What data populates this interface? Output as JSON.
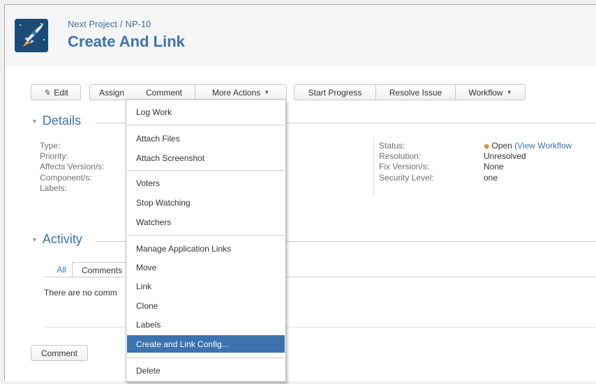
{
  "header": {
    "project": "Next Project",
    "separator": "/",
    "issue_key": "NP-10",
    "title": "Create And Link"
  },
  "toolbar": {
    "edit": "Edit",
    "assign": "Assign",
    "comment": "Comment",
    "more_actions": "More Actions",
    "start_progress": "Start Progress",
    "resolve_issue": "Resolve Issue",
    "workflow": "Workflow"
  },
  "details": {
    "heading": "Details",
    "left_labels": [
      "Type:",
      "Priority:",
      "Affects Version/s:",
      "Component/s:",
      "Labels:"
    ],
    "right": [
      {
        "label": "Status:",
        "value": "Open",
        "link": "View Workflow"
      },
      {
        "label": "Resolution:",
        "value": "Unresolved"
      },
      {
        "label": "Fix Version/s:",
        "value": "None"
      },
      {
        "label": "Security Level:",
        "value": "one"
      }
    ],
    "status_paren": "("
  },
  "activity": {
    "heading": "Activity",
    "tabs": [
      "All",
      "Comments"
    ],
    "empty_text": "There are no comm",
    "comment_button": "Comment"
  },
  "menu": {
    "groups": [
      [
        "Log Work"
      ],
      [
        "Attach Files",
        "Attach Screenshot"
      ],
      [
        "Voters",
        "Stop Watching",
        "Watchers"
      ],
      [
        "Manage Application Links",
        "Move",
        "Link",
        "Clone",
        "Labels",
        "Create and Link Config..."
      ],
      [
        "Delete"
      ]
    ],
    "highlighted": "Create and Link Config..."
  },
  "colors": {
    "accent": "#3b73af",
    "menu_highlight": "#3b73af"
  }
}
